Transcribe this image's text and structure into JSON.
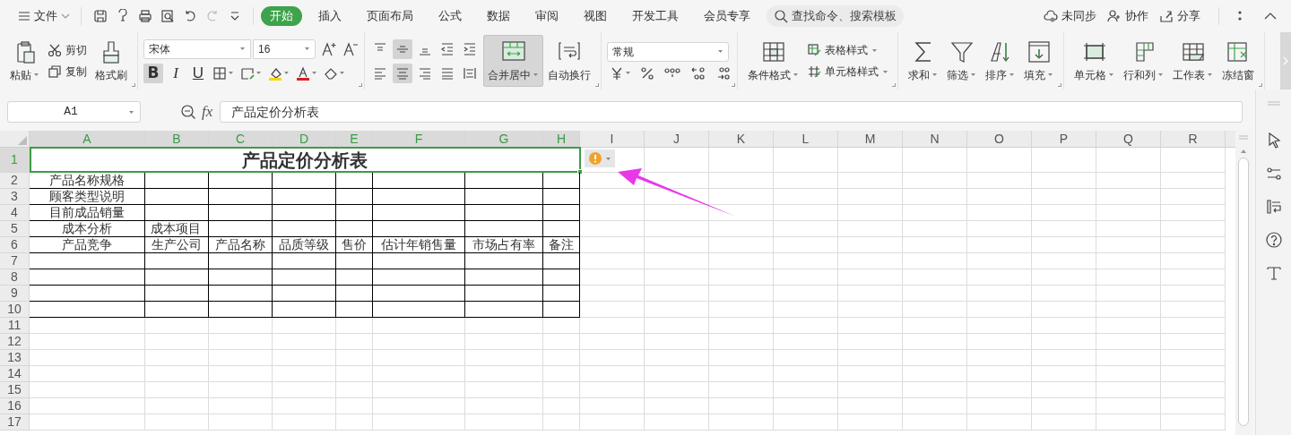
{
  "top_bar": {
    "file_menu": "文件",
    "tabs": [
      {
        "label": "开始",
        "selected": true
      },
      {
        "label": "插入",
        "selected": false
      },
      {
        "label": "页面布局",
        "selected": false
      },
      {
        "label": "公式",
        "selected": false
      },
      {
        "label": "数据",
        "selected": false
      },
      {
        "label": "审阅",
        "selected": false
      },
      {
        "label": "视图",
        "selected": false
      },
      {
        "label": "开发工具",
        "selected": false
      },
      {
        "label": "会员专享",
        "selected": false
      }
    ],
    "search_placeholder": "查找命令、搜索模板",
    "actions": [
      "未同步",
      "协作",
      "分享"
    ]
  },
  "ribbon": {
    "groups": [
      {
        "items": [
          {
            "kind": "large",
            "label": "粘贴",
            "dropdown": true
          },
          {
            "kind": "stack",
            "items": [
              {
                "label": "剪切"
              },
              {
                "label": "复制"
              }
            ]
          },
          {
            "kind": "large",
            "label": "格式刷",
            "dropdown": false
          }
        ]
      },
      {
        "items": [
          {
            "kind": "font",
            "font": "宋体",
            "size": "16",
            "tools": [
              {
                "kind": "bold",
                "label": "B",
                "selected": true
              },
              {
                "kind": "italic",
                "label": "I",
                "selected": false
              },
              {
                "kind": "underline",
                "label": "U",
                "selected": false
              },
              {
                "kind": "icon",
                "selected": false
              },
              {
                "kind": "icon",
                "selected": false
              },
              {
                "kind": "icon",
                "selected": false
              },
              {
                "kind": "icon",
                "selected": false
              },
              {
                "kind": "icon",
                "selected": false
              }
            ]
          }
        ]
      },
      {
        "items": [
          {
            "kind": "align",
            "rows": [
              [
                {
                  "selected": false
                },
                {
                  "selected": true
                },
                {
                  "selected": false
                },
                {
                  "selected": false
                },
                {
                  "selected": false
                }
              ],
              [
                {
                  "selected": false
                },
                {
                  "selected": true
                },
                {
                  "selected": false
                },
                {
                  "selected": false
                },
                {
                  "selected": false
                }
              ]
            ]
          },
          {
            "kind": "large",
            "label": "合并居中",
            "dropdown": true,
            "selected": true
          },
          {
            "kind": "large",
            "label": "自动换行",
            "dropdown": false
          }
        ]
      },
      {
        "items": [
          {
            "kind": "number",
            "format": "常规"
          }
        ]
      },
      {
        "items": [
          {
            "kind": "large",
            "label": "条件格式",
            "dropdown": true
          },
          {
            "kind": "stack",
            "items": [
              {
                "label": "表格样式",
                "dropdown": true
              },
              {
                "label": "单元格样式",
                "dropdown": true
              }
            ]
          }
        ]
      },
      {
        "items": [
          {
            "kind": "large",
            "label": "求和",
            "dropdown": true
          },
          {
            "kind": "large",
            "label": "筛选",
            "dropdown": true
          },
          {
            "kind": "large",
            "label": "排序",
            "dropdown": true
          },
          {
            "kind": "large",
            "label": "填充",
            "dropdown": true
          }
        ]
      },
      {
        "items": [
          {
            "kind": "large",
            "label": "单元格",
            "dropdown": true
          },
          {
            "kind": "large",
            "label": "行和列",
            "dropdown": true
          },
          {
            "kind": "large",
            "label": "工作表",
            "dropdown": true
          },
          {
            "kind": "large",
            "label": "冻结窗",
            "dropdown": false
          }
        ]
      }
    ]
  },
  "formula_bar": {
    "name_box": "A1",
    "fx": "fx",
    "value": "产品定价分析表"
  },
  "columns": [
    {
      "label": "A",
      "selected": true
    },
    {
      "label": "B",
      "selected": true
    },
    {
      "label": "C",
      "selected": true
    },
    {
      "label": "D",
      "selected": true
    },
    {
      "label": "E",
      "selected": true
    },
    {
      "label": "F",
      "selected": true
    },
    {
      "label": "G",
      "selected": true
    },
    {
      "label": "H",
      "selected": true
    },
    {
      "label": "I",
      "selected": false
    },
    {
      "label": "J",
      "selected": false
    },
    {
      "label": "K",
      "selected": false
    },
    {
      "label": "L",
      "selected": false
    },
    {
      "label": "M",
      "selected": false
    },
    {
      "label": "N",
      "selected": false
    },
    {
      "label": "O",
      "selected": false
    },
    {
      "label": "P",
      "selected": false
    },
    {
      "label": "Q",
      "selected": false
    },
    {
      "label": "R",
      "selected": false
    }
  ],
  "rows": [
    {
      "number": "1",
      "selected": true,
      "bordered": true,
      "cells": {
        "A": {
          "text": "产品定价分析表",
          "kind": "title"
        }
      }
    },
    {
      "number": "2",
      "selected": false,
      "bordered": true,
      "cells": {
        "A": {
          "text": "产品名称规格",
          "kind": "centered"
        }
      }
    },
    {
      "number": "3",
      "selected": false,
      "bordered": true,
      "cells": {
        "A": {
          "text": "顾客类型说明",
          "kind": "centered"
        }
      }
    },
    {
      "number": "4",
      "selected": false,
      "bordered": true,
      "cells": {
        "A": {
          "text": "目前成品销量",
          "kind": "centered"
        }
      }
    },
    {
      "number": "5",
      "selected": false,
      "bordered": true,
      "cells": {
        "A": {
          "text": "成本分析",
          "kind": "centered"
        },
        "B": {
          "text": "成本项目",
          "kind": "left"
        }
      }
    },
    {
      "number": "6",
      "selected": false,
      "bordered": true,
      "cells": {
        "A": {
          "text": "产品竞争",
          "kind": "centered"
        },
        "B": {
          "text": "生产公司",
          "kind": "centered"
        },
        "C": {
          "text": "产品名称",
          "kind": "centered"
        },
        "D": {
          "text": "品质等级",
          "kind": "centered"
        },
        "E": {
          "text": "售价",
          "kind": "centered"
        },
        "F": {
          "text": "估计年销售量",
          "kind": "centered"
        },
        "G": {
          "text": "市场占有率",
          "kind": "centered"
        },
        "H": {
          "text": "备注",
          "kind": "centered"
        }
      }
    },
    {
      "number": "7",
      "selected": false,
      "bordered": true,
      "cells": {}
    },
    {
      "number": "8",
      "selected": false,
      "bordered": true,
      "cells": {}
    },
    {
      "number": "9",
      "selected": false,
      "bordered": true,
      "cells": {}
    },
    {
      "number": "10",
      "selected": false,
      "bordered": true,
      "cells": {}
    },
    {
      "number": "11",
      "selected": false,
      "bordered": false,
      "cells": {}
    },
    {
      "number": "12",
      "selected": false,
      "bordered": false,
      "cells": {}
    },
    {
      "number": "13",
      "selected": false,
      "bordered": false,
      "cells": {}
    },
    {
      "number": "14",
      "selected": false,
      "bordered": false,
      "cells": {}
    },
    {
      "number": "15",
      "selected": false,
      "bordered": false,
      "cells": {}
    },
    {
      "number": "16",
      "selected": false,
      "bordered": false,
      "cells": {}
    },
    {
      "number": "17",
      "selected": false,
      "bordered": false,
      "cells": {}
    }
  ]
}
